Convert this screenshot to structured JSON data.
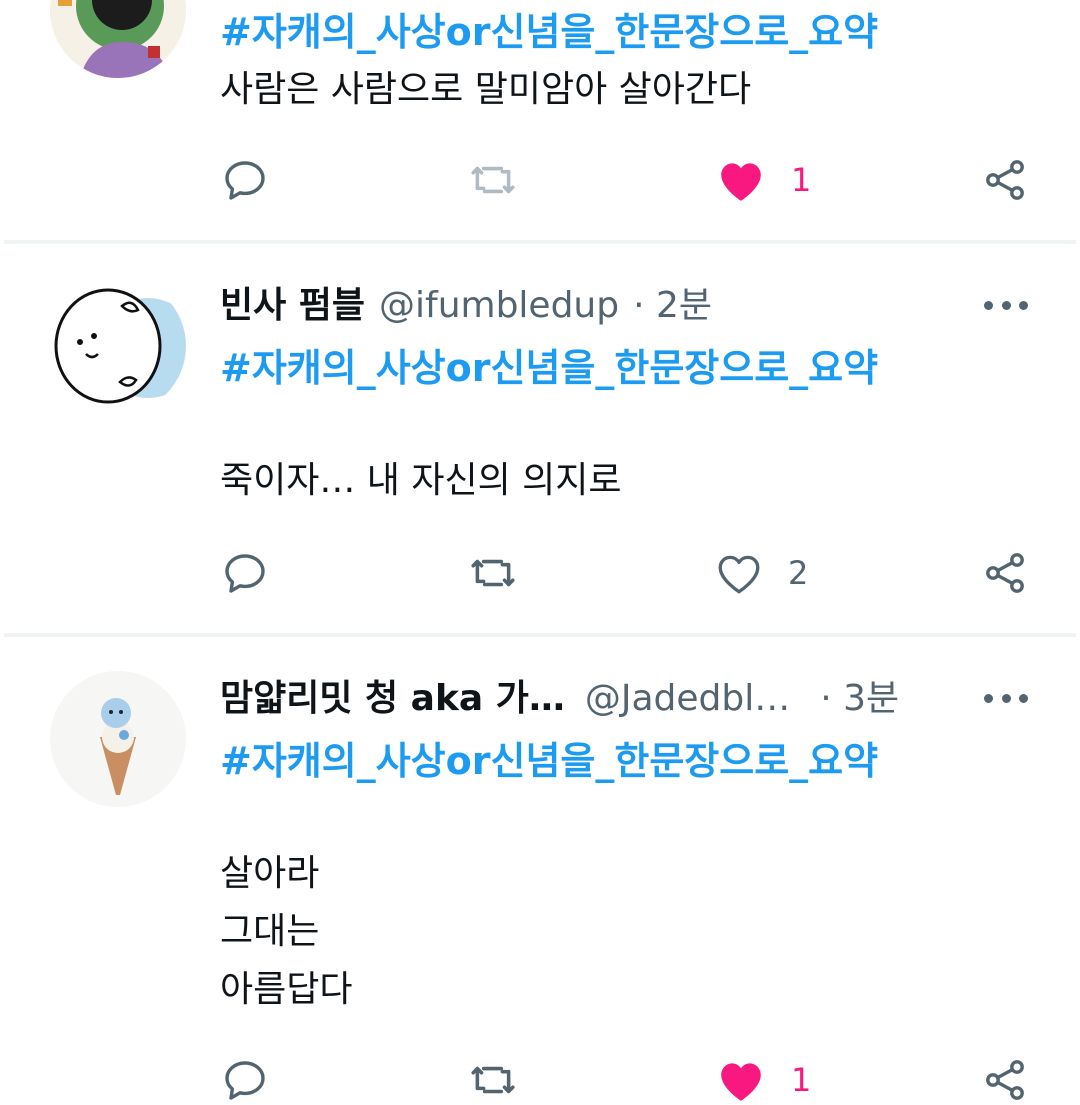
{
  "tweets": [
    {
      "hashtag": "#자캐의_사상or신념을_한문장으로_요약",
      "text": "사람은 사람으로 말미암아 살아간다",
      "likes": "1",
      "liked": true
    },
    {
      "name": "빈사 펌블",
      "handle": "@ifumbledup",
      "time": "· 2분",
      "hashtag": "#자캐의_사상or신념을_한문장으로_요약",
      "text": "죽이자… 내 자신의 의지로",
      "likes": "2",
      "liked": false
    },
    {
      "name": "맘얇리밋 청 aka 가…",
      "handle": "@Jadedbl…",
      "time": "· 3분",
      "hashtag": "#자캐의_사상or신념을_한문장으로_요약",
      "text": "살아라\n그대는\n아름답다",
      "likes": "1",
      "liked": true
    }
  ],
  "colors": {
    "accent": "#1d9bf0",
    "like": "#f91880",
    "muted": "#536471",
    "divider": "#eff3f4"
  },
  "icons": [
    "reply-icon",
    "retweet-icon",
    "heart-icon",
    "share-icon",
    "more-icon"
  ]
}
